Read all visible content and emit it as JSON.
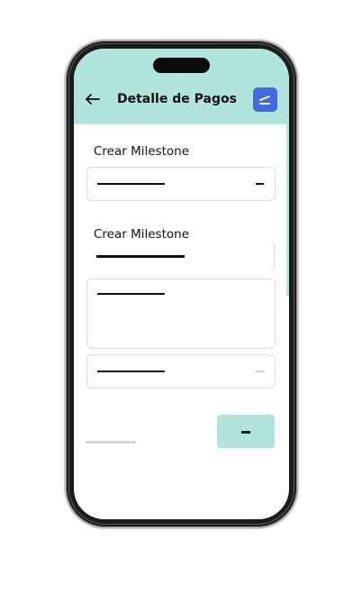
{
  "header": {
    "title": "Detalle de Pagos",
    "back_icon": "arrow-left-icon",
    "action_icon": "chart-icon",
    "background": "#b2e4de",
    "action_color": "#3f6ae0"
  },
  "form": {
    "section_one_label": "Crear Milestone",
    "section_two_label": "Crear Milestone"
  },
  "colors": {
    "accent": "#b2e4de",
    "field_border": "#dcdcdc",
    "text": "#111111"
  }
}
